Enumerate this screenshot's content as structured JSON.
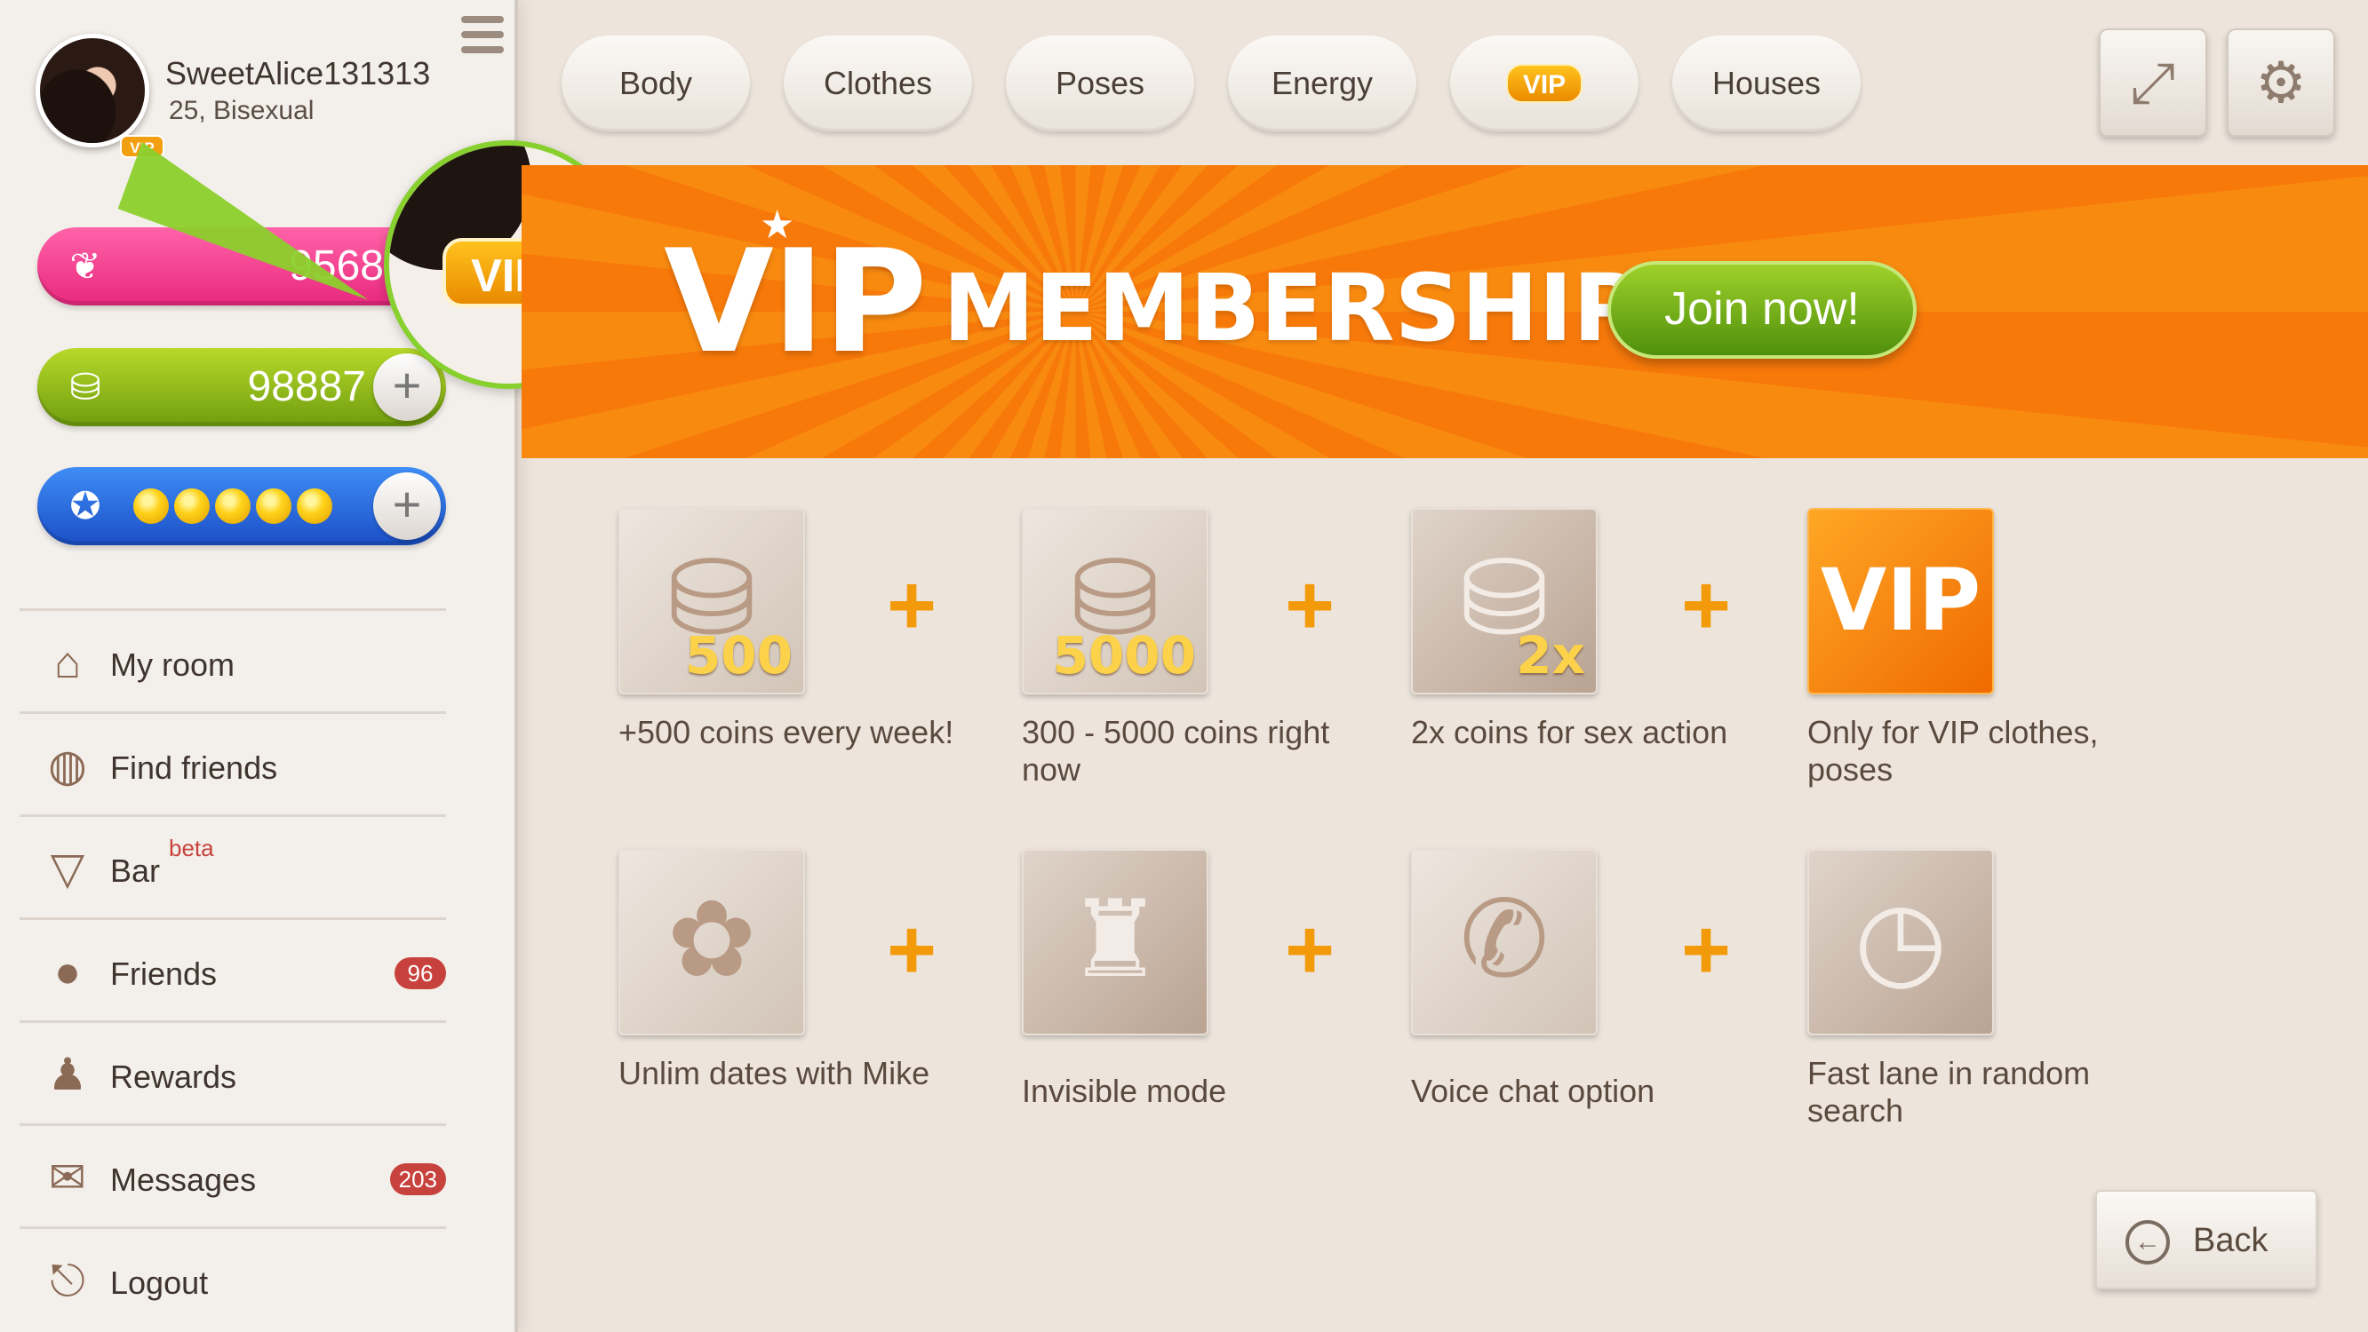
{
  "profile": {
    "username": "SweetAlice131313",
    "info": "25, Bisexual",
    "avatar_badge": "VIP"
  },
  "currencies": {
    "hearts": "9568",
    "coins": "98887",
    "energy_level": 5,
    "energy_max": 5
  },
  "magnifier_badge": "VIP",
  "menu": [
    {
      "label": "My room",
      "icon": "house-icon"
    },
    {
      "label": "Find friends",
      "icon": "globe-icon"
    },
    {
      "label": "Bar",
      "icon": "cocktail-icon",
      "tag": "beta"
    },
    {
      "label": "Friends",
      "icon": "person-icon",
      "badge": "96"
    },
    {
      "label": "Rewards",
      "icon": "person-gift-icon"
    },
    {
      "label": "Messages",
      "icon": "envelope-icon",
      "badge": "203"
    },
    {
      "label": "Logout",
      "icon": "exit-door-icon"
    }
  ],
  "tabs": [
    "Body",
    "Clothes",
    "Poses",
    "Energy",
    "VIP",
    "Houses"
  ],
  "top_buttons": {
    "expand": "expand-icon",
    "settings": "gear-icon"
  },
  "banner": {
    "vip": "VIP",
    "membership": "MEMBERSHIP",
    "join": "Join now!"
  },
  "benefits": [
    {
      "caption": "+500 coins every week!",
      "badge": "500",
      "icon": "coin-stack-icon"
    },
    {
      "caption": "300 - 5000 coins right now",
      "badge": "5000",
      "icon": "coin-stack-icon"
    },
    {
      "caption": "2x coins for sex action",
      "badge": "2x",
      "icon": "coin-stack-icon"
    },
    {
      "caption": "Only for VIP clothes, poses",
      "badge": "VIP",
      "icon": "vip-star-icon"
    },
    {
      "caption": "Unlim dates with Mike",
      "icon": "flower-bouquet-icon"
    },
    {
      "caption": "Invisible mode",
      "icon": "spy-icon"
    },
    {
      "caption": "Voice chat option",
      "icon": "phone-icon"
    },
    {
      "caption": "Fast lane in random search",
      "icon": "clock-icon"
    }
  ],
  "plus": "+",
  "back": "Back",
  "colors": {
    "banner_orange": "#f7790a",
    "join_green": "#6fae15",
    "badge_red": "#c8423d",
    "vip_gold": "#f2a00f"
  }
}
